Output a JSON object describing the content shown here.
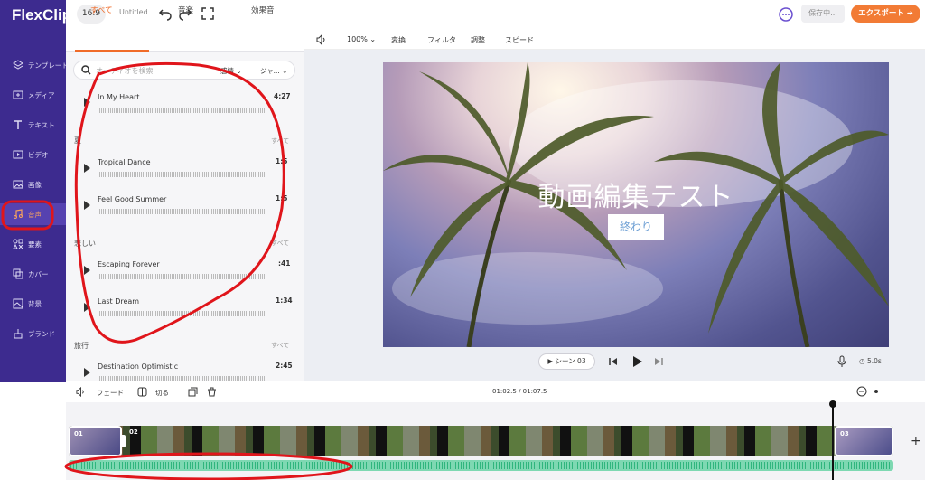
{
  "header": {
    "logo": "FlexClip",
    "ratio": "16:9",
    "project_title": "Untitled",
    "saving": "保存中...",
    "export": "エクスポート ➜"
  },
  "sidebar": {
    "items": [
      {
        "label": "テンプレート",
        "icon": "layers-icon"
      },
      {
        "label": "メディア",
        "icon": "media-icon"
      },
      {
        "label": "テキスト",
        "icon": "text-icon"
      },
      {
        "label": "ビデオ",
        "icon": "video-icon"
      },
      {
        "label": "画像",
        "icon": "image-icon"
      },
      {
        "label": "音声",
        "icon": "music-icon",
        "active": true
      },
      {
        "label": "要素",
        "icon": "elements-icon"
      },
      {
        "label": "カバー",
        "icon": "cover-icon"
      },
      {
        "label": "背景",
        "icon": "background-icon"
      },
      {
        "label": "ブランド",
        "icon": "brand-icon"
      }
    ]
  },
  "panel": {
    "tabs": [
      "すべて",
      "音楽",
      "効果音"
    ],
    "search_placeholder": "オーディオを検索",
    "mood": "感情",
    "genre": "ジャ...",
    "tracks": [
      {
        "name": "In My Heart",
        "duration": "4:27"
      },
      {
        "name": "Tropical Dance",
        "duration": "1:5"
      },
      {
        "name": "Feel Good Summer",
        "duration": "1:5"
      },
      {
        "name": "Escaping Forever",
        "duration": ":41"
      },
      {
        "name": "Last Dream",
        "duration": "1:34"
      },
      {
        "name": "Destination Optimistic",
        "duration": "2:45"
      }
    ],
    "categories": [
      "夏",
      "悲しい",
      "旅行"
    ],
    "see_all": "すべて"
  },
  "edit_toolbar": {
    "zoom": "100%",
    "transform": "変換",
    "filter": "フィルタ",
    "adjust": "調整",
    "speed": "スピード"
  },
  "canvas": {
    "title_text": "動画編集テスト",
    "button_text": "終わり",
    "scene": "シーン 03",
    "duration": "5.0s"
  },
  "timeline": {
    "fade": "フェード",
    "cut": "切る",
    "timecode": "01:02.5 / 01:07.5",
    "clips": [
      "01",
      "02",
      "03"
    ]
  },
  "colors": {
    "sidebar": "#3d2b8f",
    "accent": "#f06b28",
    "export": "#f27b35",
    "annotation": "#e0151b",
    "audio_track": "#7ed8b2"
  }
}
